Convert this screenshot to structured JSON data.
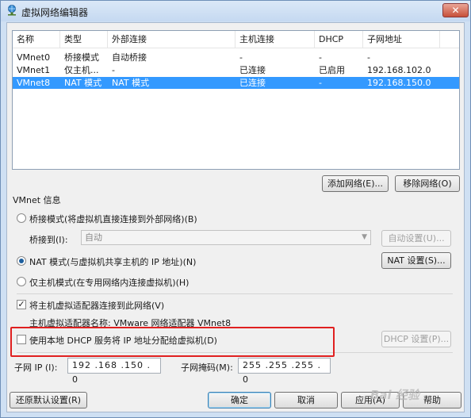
{
  "window": {
    "title": "虚拟网络编辑器",
    "close_symbol": "✕"
  },
  "table": {
    "headers": [
      "名称",
      "类型",
      "外部连接",
      "主机连接",
      "DHCP",
      "子网地址"
    ],
    "rows": [
      {
        "name": "VMnet0",
        "type": "桥接模式",
        "external": "自动桥接",
        "host": "-",
        "dhcp": "-",
        "subnet": "-",
        "selected": false
      },
      {
        "name": "VMnet1",
        "type": "仅主机...",
        "external": "-",
        "host": "已连接",
        "dhcp": "已启用",
        "subnet": "192.168.102.0",
        "selected": false
      },
      {
        "name": "VMnet8",
        "type": "NAT 模式",
        "external": "NAT 模式",
        "host": "已连接",
        "dhcp": "-",
        "subnet": "192.168.150.0",
        "selected": true
      }
    ]
  },
  "list_buttons": {
    "add": "添加网络(E)...",
    "remove": "移除网络(O)"
  },
  "vmnet_info": {
    "group_title": "VMnet 信息",
    "bridge_radio": "桥接模式(将虚拟机直接连接到外部网络)(B)",
    "bridge_to_label": "桥接到(I):",
    "bridge_to_value": "自动",
    "auto_settings": "自动设置(U)...",
    "nat_radio": "NAT 模式(与虚拟机共享主机的 IP 地址)(N)",
    "nat_settings": "NAT 设置(S)...",
    "host_only_radio": "仅主机模式(在专用网络内连接虚拟机)(H)",
    "connect_adapter_check": "将主机虚拟适配器连接到此网络(V)",
    "adapter_name": "主机虚拟适配器名称: VMware 网络适配器 VMnet8",
    "dhcp_check": "使用本地 DHCP 服务将 IP 地址分配给虚拟机(D)",
    "dhcp_settings": "DHCP 设置(P)...",
    "subnet_ip_label": "子网 IP (I):",
    "subnet_ip_value": "192 .168 .150 . 0",
    "subnet_mask_label": "子网掩码(M):",
    "subnet_mask_value": "255 .255 .255 . 0",
    "selected_mode": "nat",
    "connect_adapter_checked": true,
    "dhcp_checked": false
  },
  "footer": {
    "restore": "还原默认设置(R)",
    "ok": "确定",
    "cancel": "取消",
    "apply": "应用(A)",
    "help": "帮助"
  },
  "watermark": "Bai 经验",
  "colors": {
    "selection": "#3399ff",
    "highlight_box": "#e02020",
    "title_bar": "#c5d9f1"
  }
}
